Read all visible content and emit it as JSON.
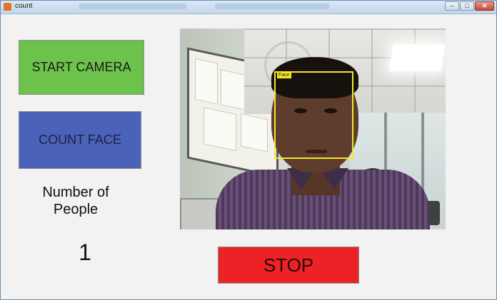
{
  "window": {
    "title": "count",
    "minimize_glyph": "–",
    "maximize_glyph": "□",
    "close_glyph": "✕"
  },
  "controls": {
    "start_camera_label": "START CAMERA",
    "count_face_label": "COUNT FACE",
    "stop_label": "STOP"
  },
  "result": {
    "label_line1": "Number of",
    "label_line2": "People",
    "value": "1"
  },
  "camera": {
    "face_label": "Face"
  },
  "colors": {
    "start_button": "#6cc24a",
    "count_button": "#4a62b8",
    "stop_button": "#ec2227",
    "face_box": "#f3e92a"
  }
}
